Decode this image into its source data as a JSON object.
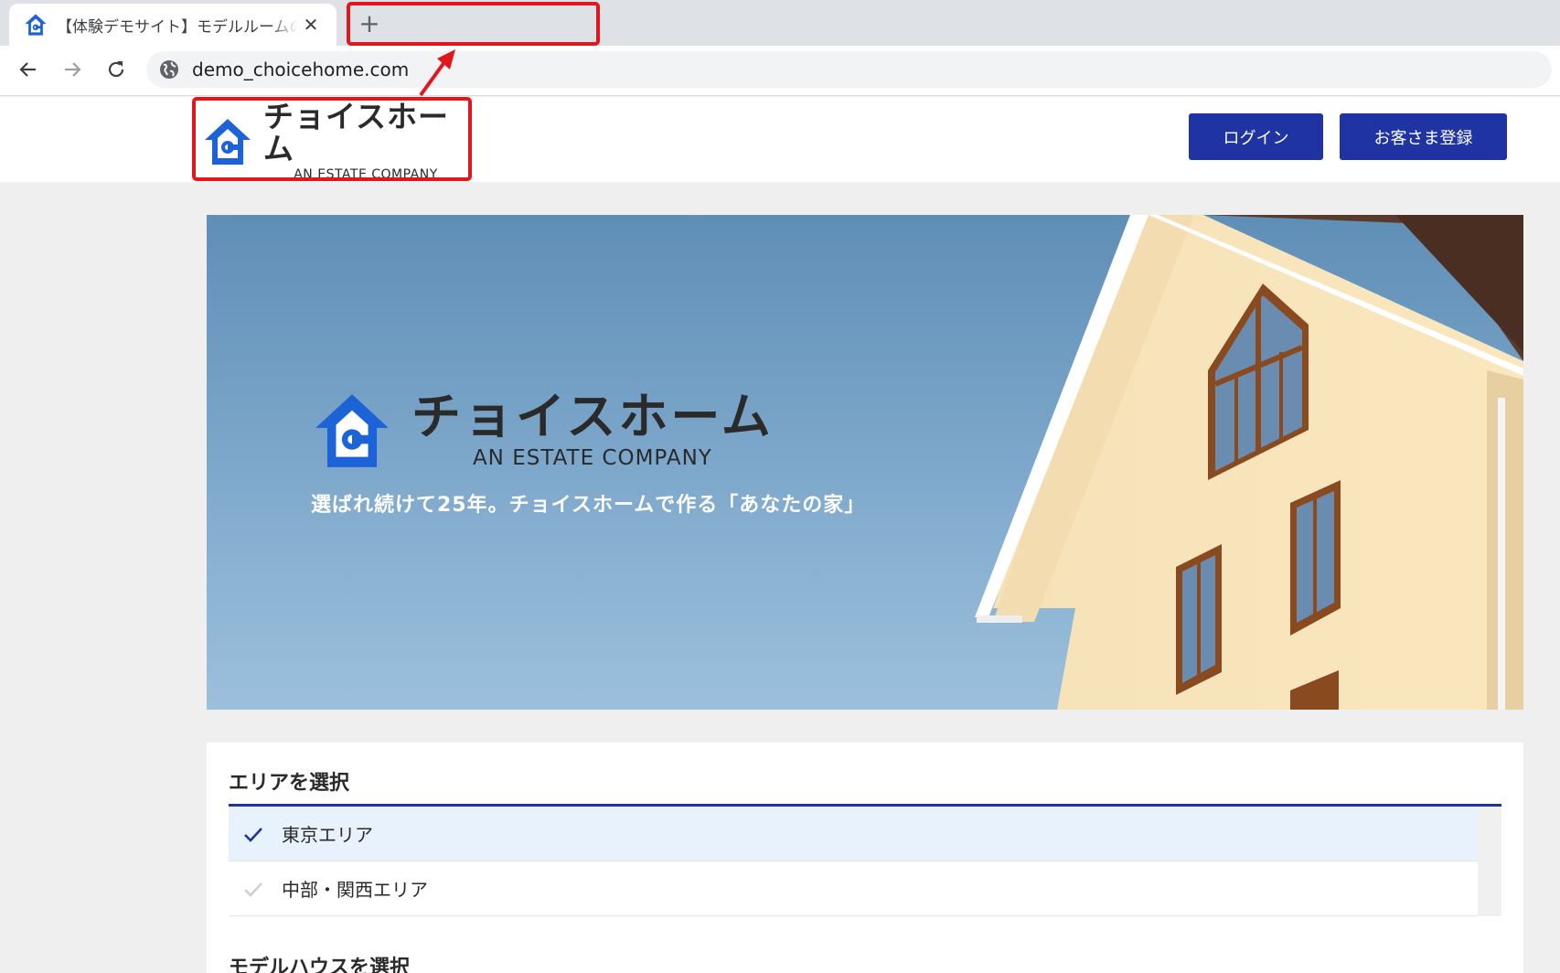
{
  "browser": {
    "tab": {
      "title": "【体験デモサイト】モデルルームの見学予約",
      "close_glyph": "✕"
    },
    "new_tab_glyph": "+",
    "address": "demo_choicehome.com"
  },
  "header": {
    "logo": {
      "name": "チョイスホーム",
      "subtitle": "AN ESTATE COMPANY"
    },
    "login_label": "ログイン",
    "register_label": "お客さま登録"
  },
  "hero": {
    "logo": {
      "name": "チョイスホーム",
      "subtitle": "AN ESTATE COMPANY"
    },
    "tagline": "選ばれ続けて25年。チョイスホームで作る「あなたの家」"
  },
  "area_section": {
    "title": "エリアを選択",
    "items": [
      {
        "label": "東京エリア",
        "selected": true
      },
      {
        "label": "中部・関西エリア",
        "selected": false
      }
    ]
  },
  "model_section": {
    "title": "モデルハウスを選択"
  },
  "colors": {
    "brand_blue": "#1f33a3",
    "logo_blue": "#1d63d8",
    "highlight_red": "#e3161e"
  }
}
